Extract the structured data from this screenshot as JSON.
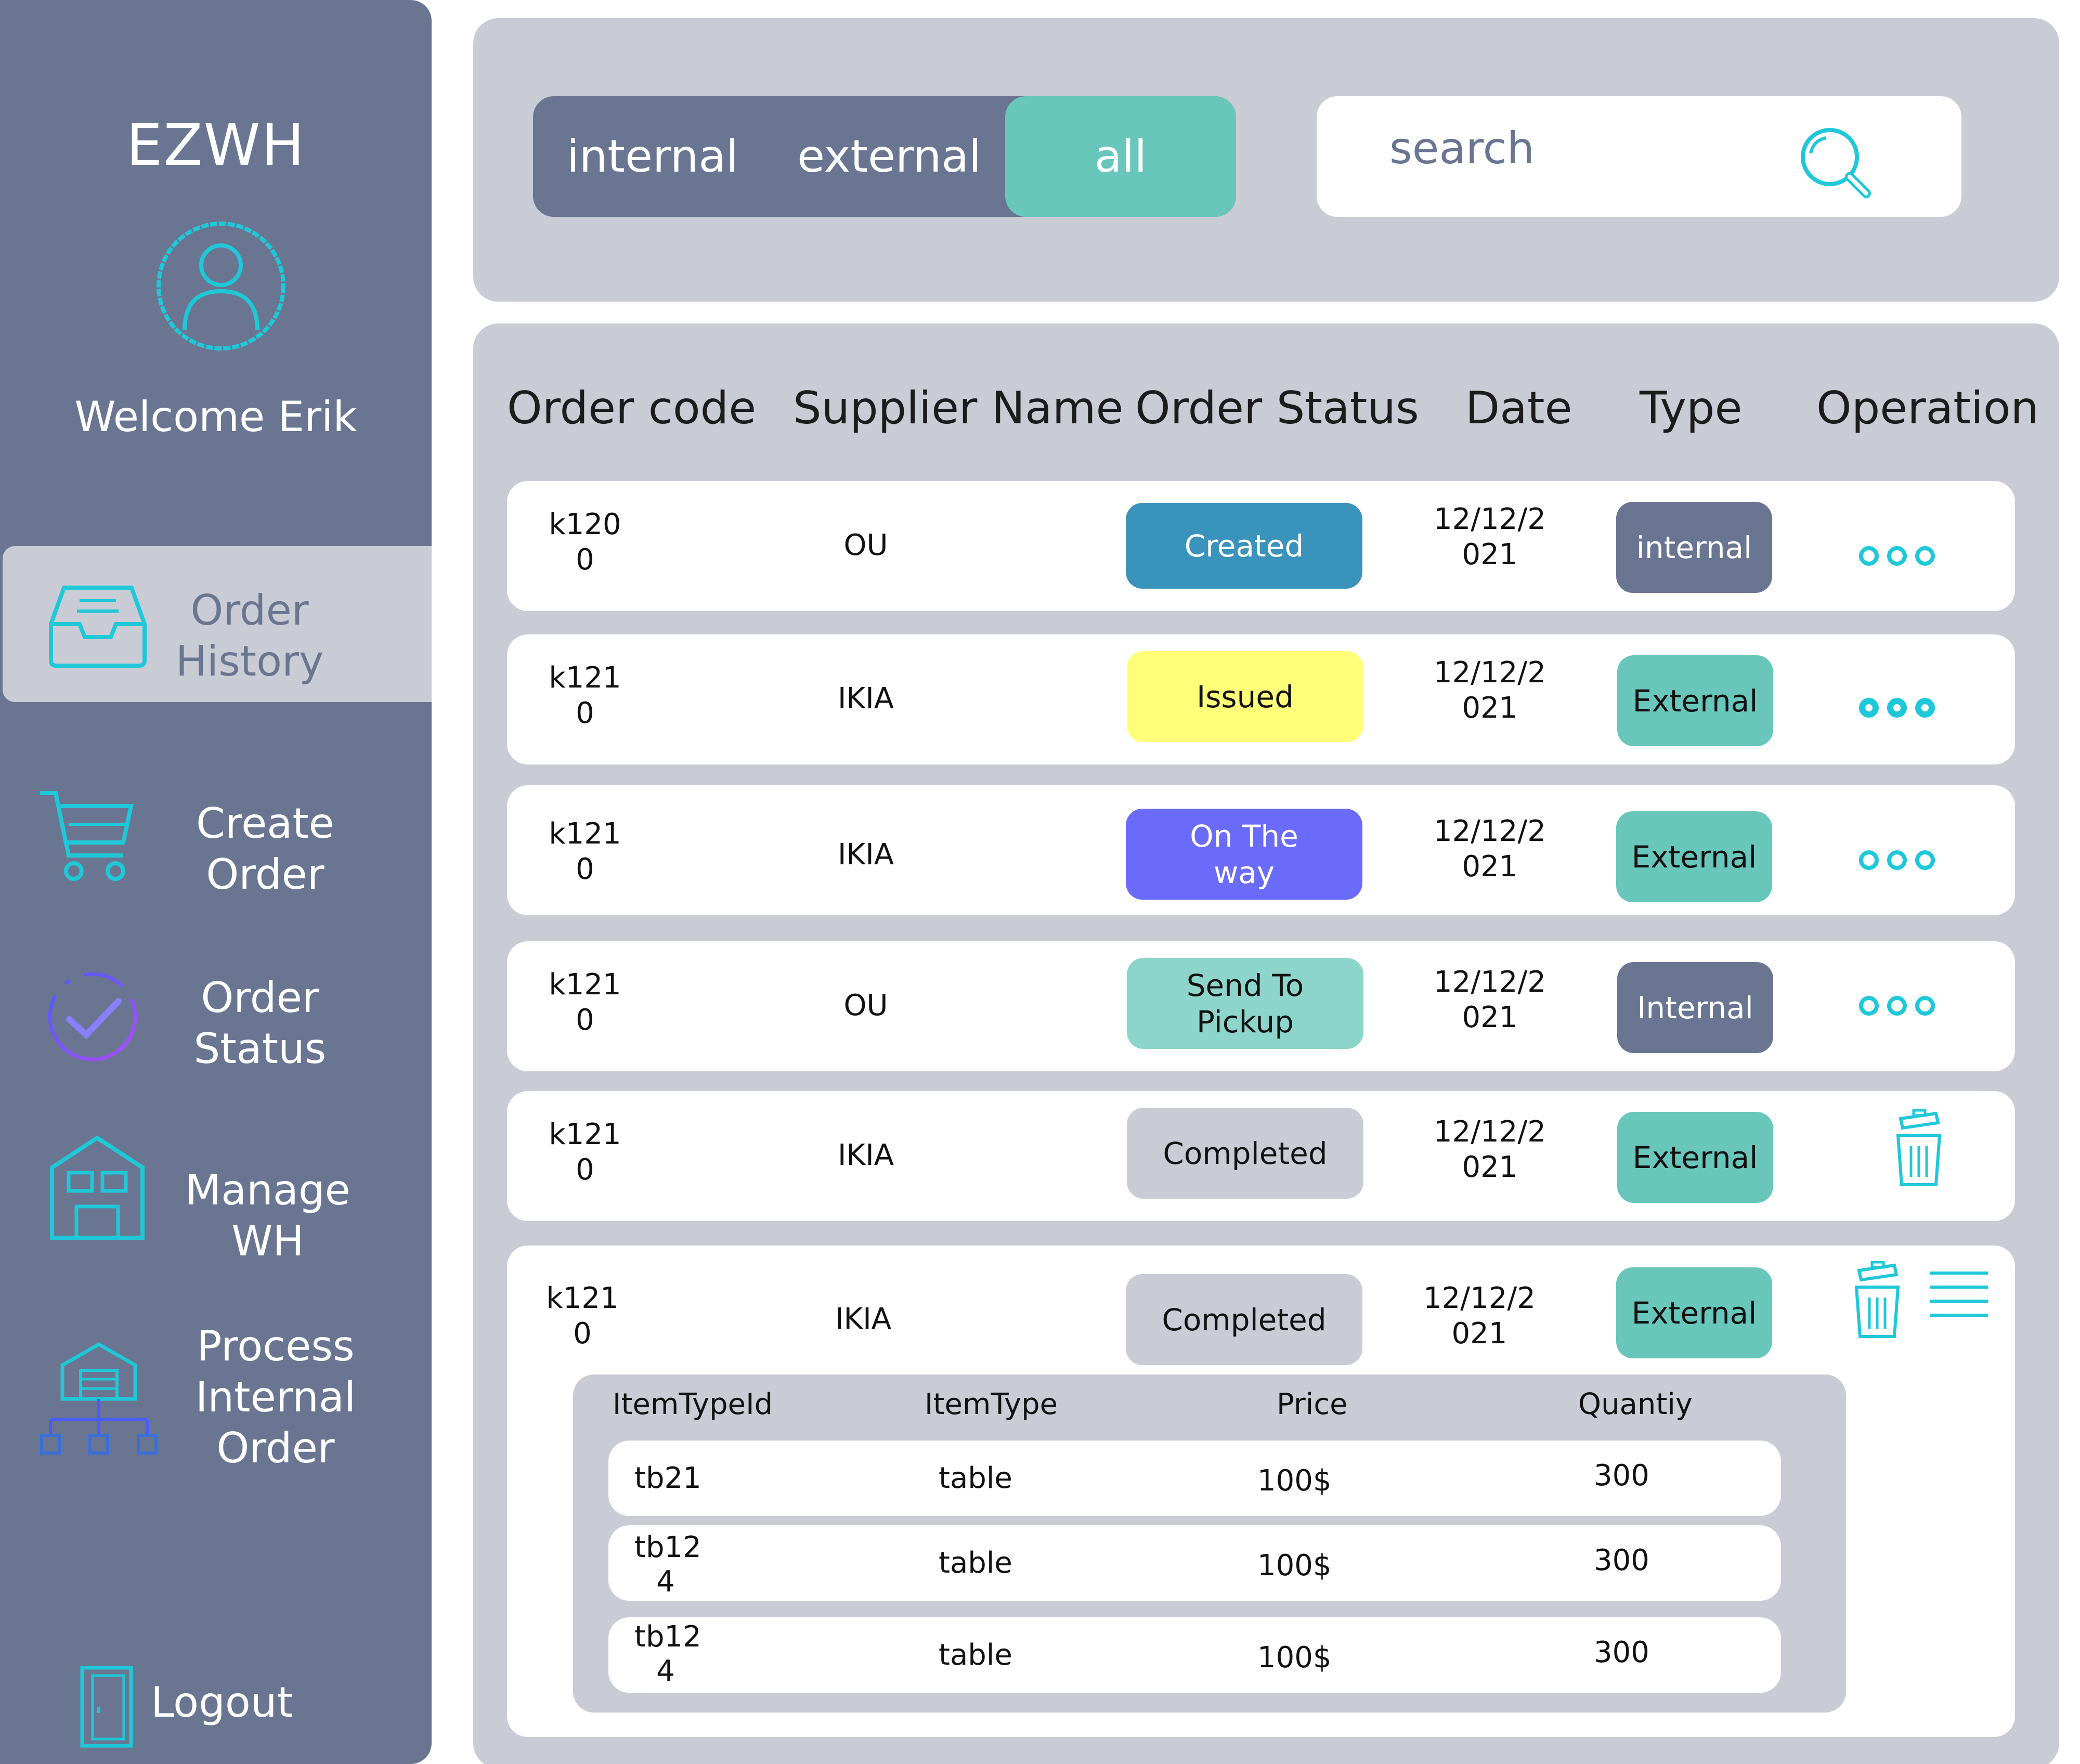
{
  "sidebar": {
    "brand": "EZWH",
    "welcome": "Welcome Erik",
    "nav": [
      {
        "id": "order-history",
        "lines": [
          "Order",
          "History"
        ],
        "icon": "inbox-tray-icon",
        "active": true
      },
      {
        "id": "create-order",
        "lines": [
          "Create",
          "Order"
        ],
        "icon": "shopping-cart-icon",
        "active": false
      },
      {
        "id": "order-status",
        "lines": [
          "Order",
          "Status"
        ],
        "icon": "check-circle-icon",
        "active": false
      },
      {
        "id": "manage-wh",
        "lines": [
          "Manage",
          "WH"
        ],
        "icon": "warehouse-icon",
        "active": false
      },
      {
        "id": "process-internal-order",
        "lines": [
          "Process",
          "Internal",
          "Order"
        ],
        "icon": "warehouse-network-icon",
        "active": false
      }
    ],
    "logout": {
      "label": "Logout",
      "icon": "door-icon"
    }
  },
  "filter": {
    "segments": [
      "internal",
      "external",
      "all"
    ],
    "selected": "all",
    "search_placeholder": "search"
  },
  "orders": {
    "columns": [
      "Order code",
      "Supplier Name",
      "Order Status",
      "Date",
      "Type",
      "Operation"
    ],
    "rows": [
      {
        "code": [
          "k120",
          "0"
        ],
        "supplier": "OU",
        "status": [
          "Created"
        ],
        "status_color": "#3a93bb",
        "status_text_color": "#ffffff",
        "date": [
          "12/12/2",
          "021"
        ],
        "type": "internal",
        "type_color": "#6a7591",
        "type_text_color": "#ffffff",
        "operation": "more-icon"
      },
      {
        "code": [
          "k121",
          "0"
        ],
        "supplier": "IKIA",
        "status": [
          "Issued"
        ],
        "status_color": "#ffff7a",
        "status_text_color": "#111111",
        "date": [
          "12/12/2",
          "021"
        ],
        "type": "External",
        "type_color": "#68c6bb",
        "type_text_color": "#111111",
        "operation": "more-icon"
      },
      {
        "code": [
          "k121",
          "0"
        ],
        "supplier": "IKIA",
        "status": [
          "On The",
          "way"
        ],
        "status_color": "#6a6bfb",
        "status_text_color": "#ffffff",
        "date": [
          "12/12/2",
          "021"
        ],
        "type": "External",
        "type_color": "#68c6bb",
        "type_text_color": "#111111",
        "operation": "more-icon"
      },
      {
        "code": [
          "k121",
          "0"
        ],
        "supplier": "OU",
        "status": [
          "Send To",
          "Pickup"
        ],
        "status_color": "#8dd5ca",
        "status_text_color": "#111111",
        "date": [
          "12/12/2",
          "021"
        ],
        "type": "Internal",
        "type_color": "#6a7591",
        "type_text_color": "#ffffff",
        "operation": "more-icon"
      },
      {
        "code": [
          "k121",
          "0"
        ],
        "supplier": "IKIA",
        "status": [
          "Completed"
        ],
        "status_color": "#c9ccd4",
        "status_text_color": "#111111",
        "date": [
          "12/12/2",
          "021"
        ],
        "type": "External",
        "type_color": "#68c6bb",
        "type_text_color": "#111111",
        "operation": "trash-icon"
      },
      {
        "code": [
          "k121",
          "0"
        ],
        "supplier": "IKIA",
        "status": [
          "Completed"
        ],
        "status_color": "#c9ccd4",
        "status_text_color": "#111111",
        "date": [
          "12/12/2",
          "021"
        ],
        "type": "External",
        "type_color": "#68c6bb",
        "type_text_color": "#111111",
        "operation": "trash-and-menu-icons"
      }
    ]
  },
  "items": {
    "columns": [
      "ItemTypeId",
      "ItemType",
      "Price",
      "Quantiy"
    ],
    "rows": [
      {
        "id": [
          "tb21"
        ],
        "type": "table",
        "price": "100$",
        "qty": "300"
      },
      {
        "id": [
          "tb12",
          "4"
        ],
        "type": "table",
        "price": "100$",
        "qty": "300"
      },
      {
        "id": [
          "tb12",
          "4"
        ],
        "type": "table",
        "price": "100$",
        "qty": "300"
      }
    ]
  },
  "colors": {
    "sidebar": "#6a7591",
    "panel": "#c9ccd4",
    "accent": "#68c6bb",
    "icon": "#1ec8d8"
  }
}
